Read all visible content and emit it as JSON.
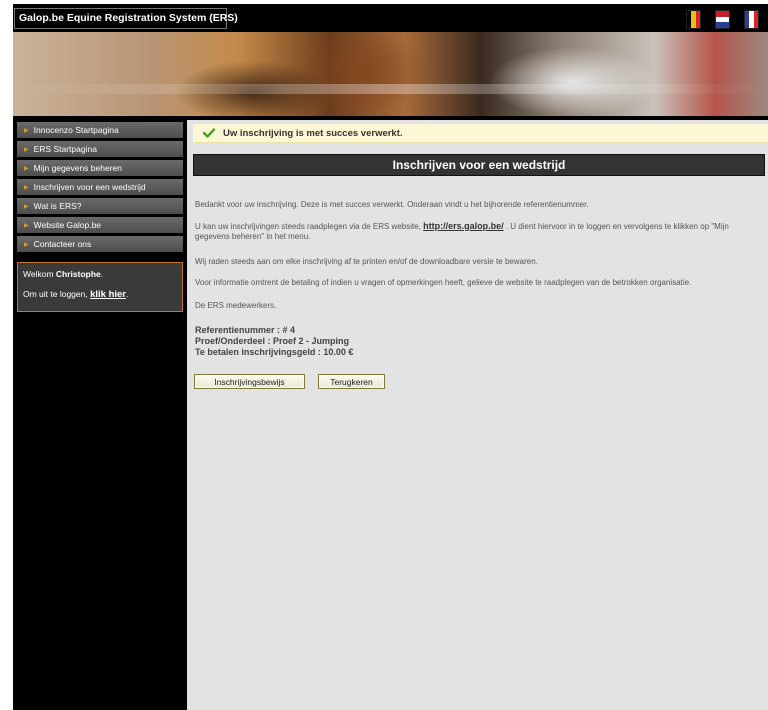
{
  "header": {
    "title": "Galop.be Equine Registration System (ERS)"
  },
  "languages": [
    "de-flag-icon",
    "nl-flag-icon",
    "fr-flag-icon"
  ],
  "colors": {
    "flag_de": [
      "#000000",
      "#e8c21a",
      "#d62828"
    ],
    "flag_nl": [
      "#c8202a",
      "#ffffff",
      "#2a3f8f"
    ],
    "flag_fr": [
      "#2a3f8f",
      "#ffffff",
      "#d62828"
    ],
    "accent": "#c4741e",
    "success_check": "#4aa02c"
  },
  "sidebar": {
    "items": [
      {
        "label": "Innocenzo Startpagina"
      },
      {
        "label": "ERS Startpagina"
      },
      {
        "label": "Mijn gegevens beheren"
      },
      {
        "label": "Inschrijven voor een wedstrijd"
      },
      {
        "label": "Wat is ERS?"
      },
      {
        "label": "Website Galop.be"
      },
      {
        "label": "Contacteer ons"
      }
    ],
    "welcome": {
      "prefix": "Welkom ",
      "user": "Christophe",
      "suffix": ".",
      "logout_text": "Om uit te loggen, ",
      "logout_link": "klik hier",
      "logout_end": "."
    }
  },
  "main": {
    "success_message": "Uw inschrijving is met succes verwerkt.",
    "heading": "Inschrijven voor een wedstrijd",
    "paragraphs": {
      "p1": "Bedankt voor uw inschrijving. Deze is met succes verwerkt. Onderaan vindt u het bijhorende referentienummer.",
      "p2_before": "U kan uw inschrijvingen steeds raadplegen via de ERS website, ",
      "p2_link": "http://ers.galop.be/",
      "p2_after": " . U dient hiervoor in te loggen en vervolgens te klikken op \"Mijn gegevens beheren\" in het menu.",
      "p3": "Wij raden steeds aan om elke inschrijving af te printen en/of de downloadbare versie te bewaren.",
      "p4": "Voor informatie omtrent de betaling of indien u vragen of opmerkingen heeft, gelieve de website te raadplegen van de betrokken organisatie.",
      "p5": "De ERS medewerkers."
    },
    "reference": {
      "line1": "Referentienummer : # 4",
      "line2": "Proef/Onderdeel : Proef 2 - Jumping",
      "line3": "Te betalen inschrijvingsgeld : 10.00 €"
    },
    "buttons": {
      "certificate": "Inschrijvingsbewijs",
      "back": "Terugkeren"
    }
  }
}
